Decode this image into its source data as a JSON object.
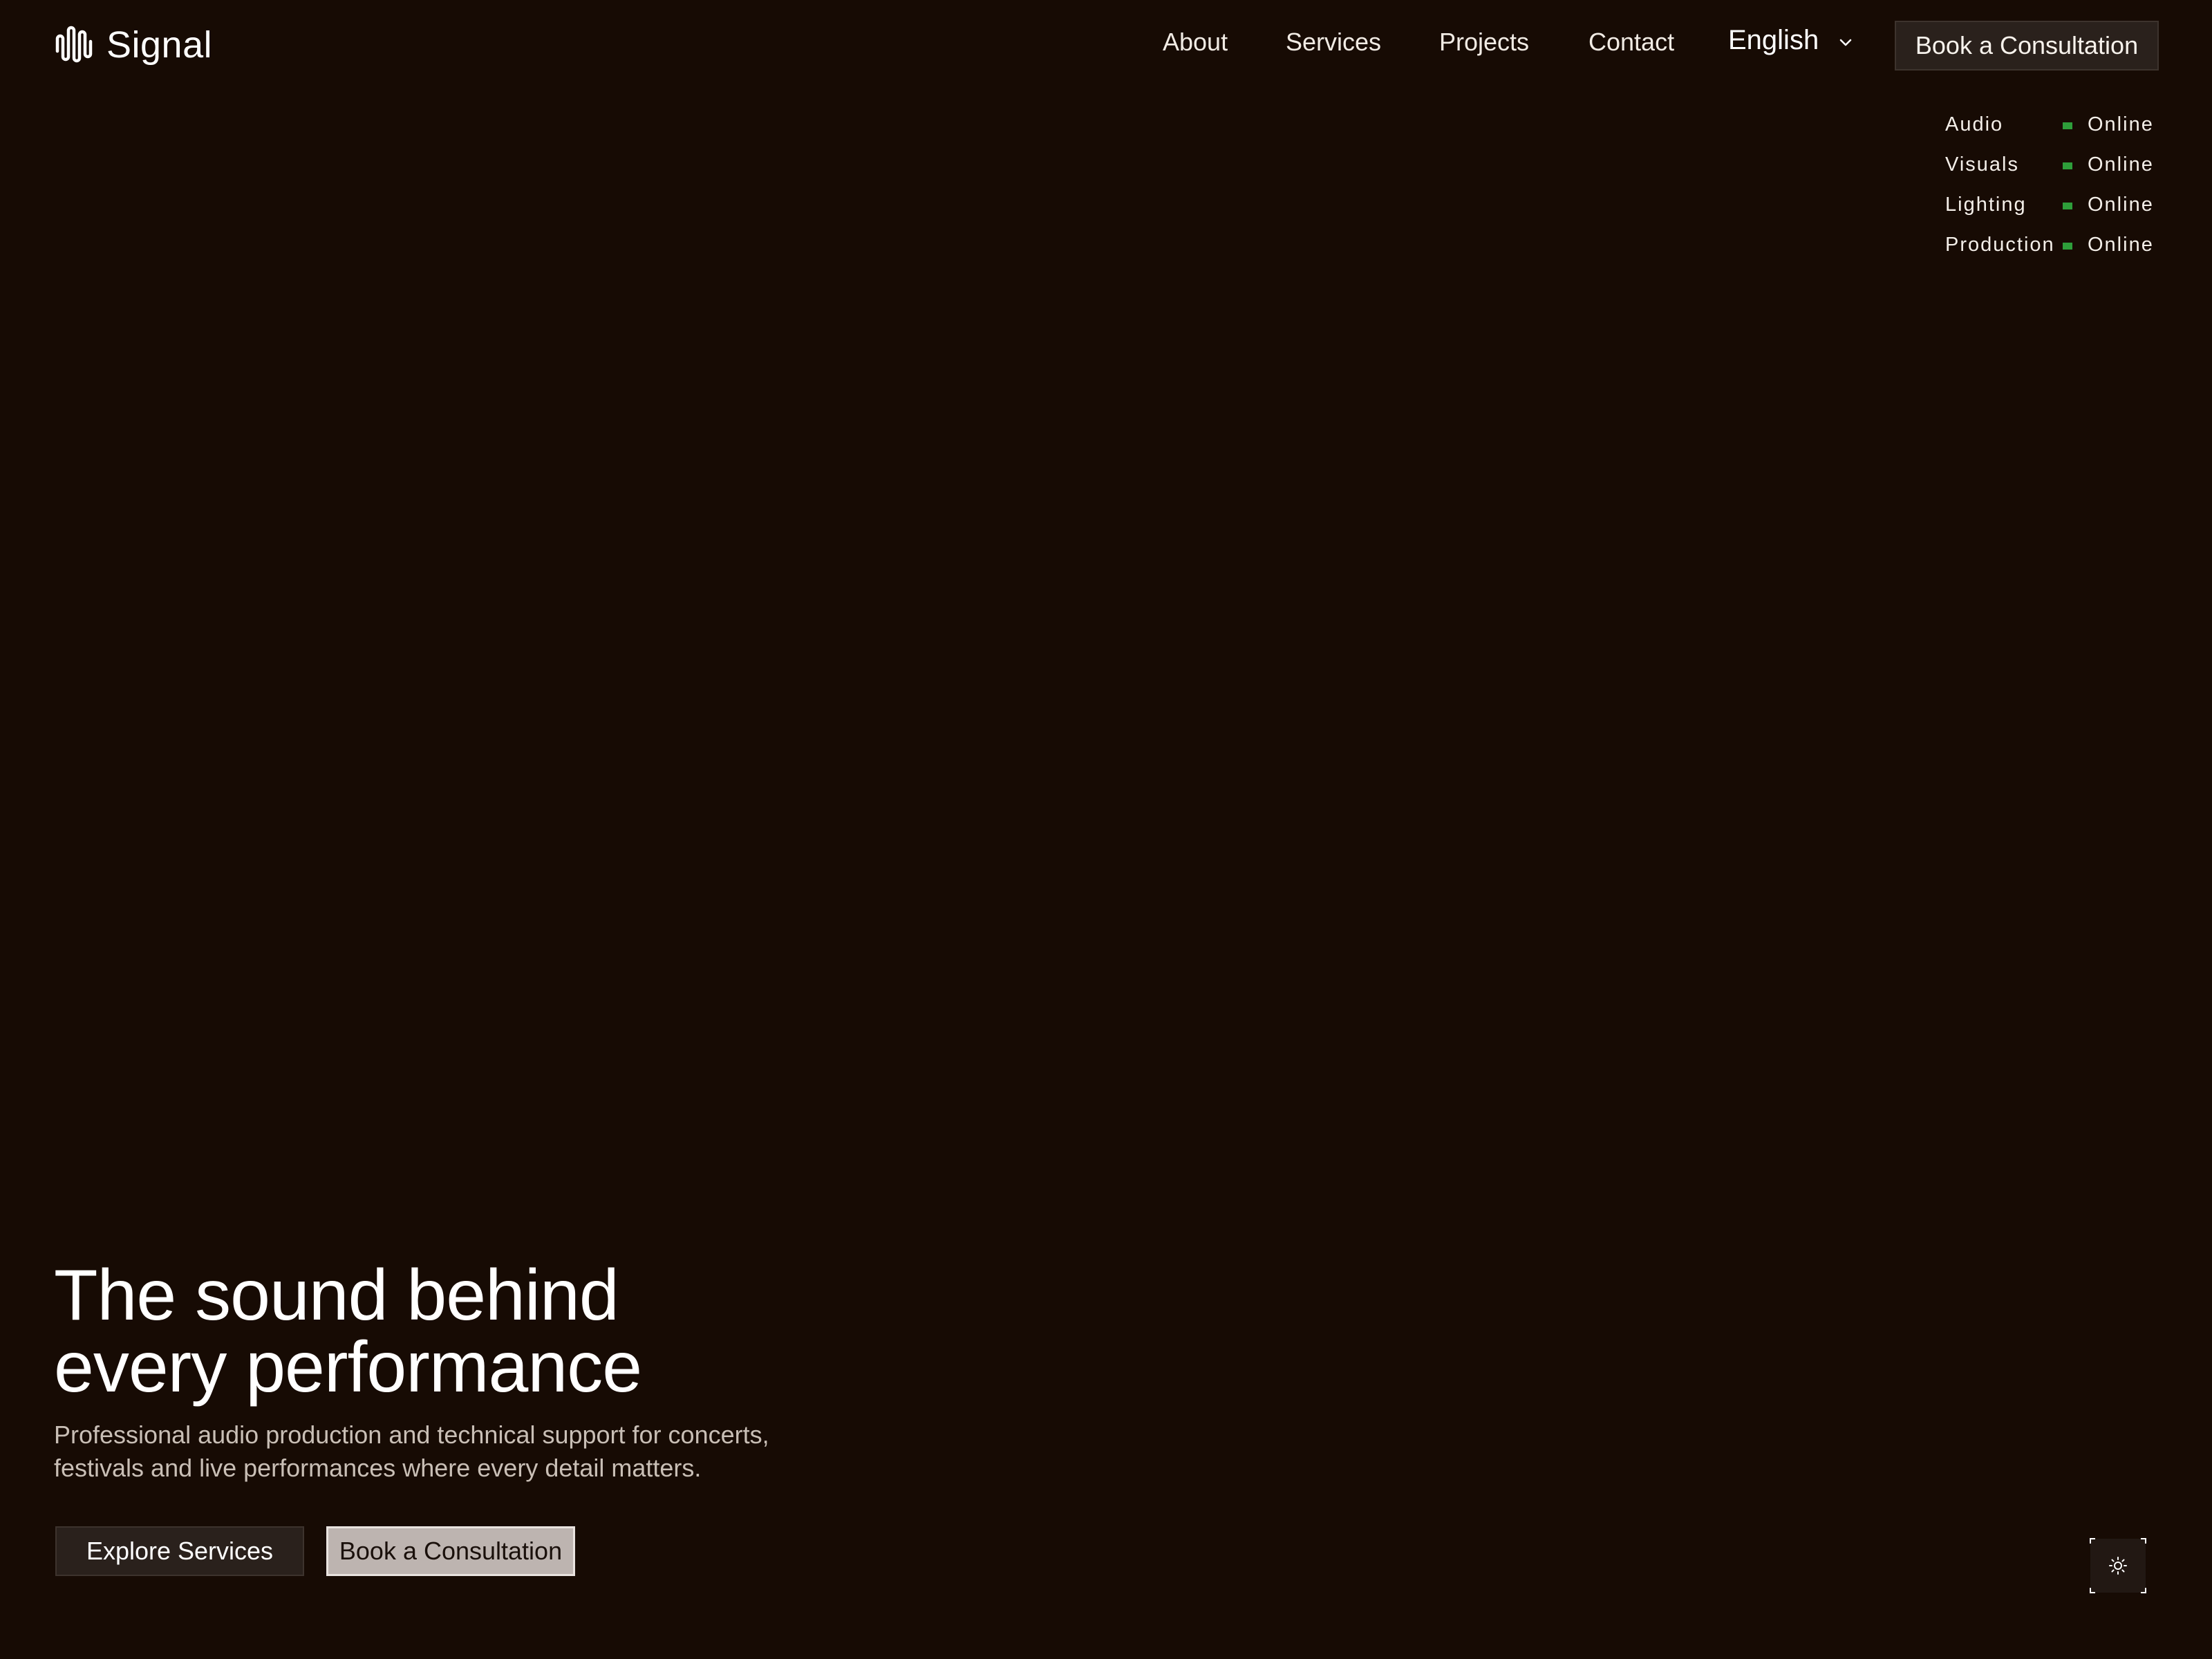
{
  "header": {
    "logo_text": "Signal",
    "logo_icon": "waveform-icon",
    "nav": [
      {
        "label": "About"
      },
      {
        "label": "Services"
      },
      {
        "label": "Projects"
      },
      {
        "label": "Contact"
      }
    ],
    "language": {
      "selected": "English",
      "icon": "chevron-down-icon"
    },
    "cta_label": "Book a Consultation"
  },
  "status": {
    "accent_color": "#2e9e3a",
    "items": [
      {
        "name": "Audio",
        "value": "Online"
      },
      {
        "name": "Visuals",
        "value": "Online"
      },
      {
        "name": "Lighting",
        "value": "Online"
      },
      {
        "name": "Production",
        "value": "Online"
      }
    ]
  },
  "hero": {
    "title_lines": [
      "The sound behind",
      "every performance"
    ],
    "subtitle_lines": [
      "Professional audio production and technical support for concerts,",
      "festivals and live performances where every detail matters."
    ],
    "primary_button": "Explore Services",
    "secondary_button": "Book a Consultation"
  },
  "theme_toggle": {
    "icon": "sun-icon"
  },
  "colors": {
    "background": "#170b04",
    "button_dark": "#2a211c",
    "button_light": "#bdb4b0",
    "text": "#f4efe9"
  }
}
